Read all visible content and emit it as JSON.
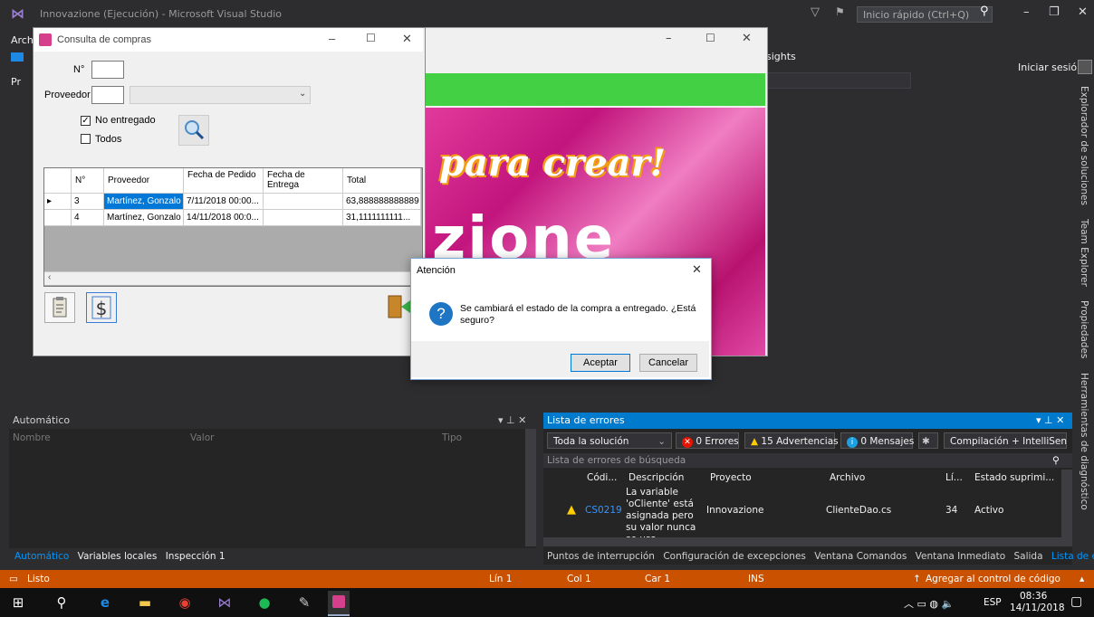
{
  "vs": {
    "title": "Innovazione (Ejecución) - Microsoft Visual Studio",
    "quick_launch_placeholder": "Inicio rápido (Ctrl+Q)",
    "sign_in": "Iniciar sesión",
    "menu_partial": "Arch",
    "insights_partial": "sights",
    "left_partial": "Pr",
    "right_tabs": [
      "Explorador de soluciones",
      "Team Explorer",
      "Propiedades",
      "Herramientas de diagnóstico"
    ]
  },
  "consulta": {
    "title": "Consulta de compras",
    "nro_label": "N°",
    "proveedor_label": "Proveedor",
    "no_entregado_label": "No entregado",
    "no_entregado_checked": true,
    "todos_label": "Todos",
    "todos_checked": false,
    "grid_headers": [
      "N°",
      "Proveedor",
      "Fecha de Pedido",
      "Fecha de Entrega",
      "Total"
    ],
    "rows": [
      {
        "n": "3",
        "proveedor": "Martínez, Gonzalo",
        "fecha_pedido": "7/11/2018 00:00...",
        "fecha_entrega": "",
        "total": "63,888888888889"
      },
      {
        "n": "4",
        "proveedor": "Martínez, Gonzalo",
        "fecha_pedido": "14/11/2018 00:0...",
        "fecha_entrega": "",
        "total": "31,1111111111..."
      }
    ]
  },
  "image_form": {
    "text1": "para crear!",
    "text2": "zione"
  },
  "dialog": {
    "title": "Atención",
    "message": "Se cambiará el estado de la compra a entregado. ¿Está seguro?",
    "ok_label": "Aceptar",
    "cancel_label": "Cancelar"
  },
  "auto_panel": {
    "title": "Automático",
    "columns": [
      "Nombre",
      "Valor",
      "Tipo"
    ],
    "tabs": [
      "Automático",
      "Variables locales",
      "Inspección 1"
    ]
  },
  "errors_panel": {
    "title": "Lista de errores",
    "scope": "Toda la solución",
    "errors_label": "0 Errores",
    "warnings_label": "15 Advertencias",
    "messages_label": "0 Mensajes",
    "build_filter": "Compilación + IntelliSen",
    "search_placeholder": "Lista de errores de búsqueda",
    "columns": [
      "Códi...",
      "Descripción",
      "Proyecto",
      "Archivo",
      "Lí...",
      "Estado suprimi..."
    ],
    "row": {
      "code": "CS0219",
      "description": "La variable 'oCliente' está asignada pero su valor nunca se usa",
      "project": "Innovazione",
      "file": "ClienteDao.cs",
      "line": "34",
      "state": "Activo"
    },
    "bottom_tabs": [
      "Puntos de interrupción",
      "Configuración de excepciones",
      "Ventana Comandos",
      "Ventana Inmediato",
      "Salida",
      "Lista de errores"
    ]
  },
  "statusbar": {
    "status": "Listo",
    "line": "Lín 1",
    "col": "Col 1",
    "car": "Car 1",
    "ins": "INS",
    "source_control": "Agregar al control de código fuente"
  },
  "taskbar": {
    "lang": "ESP",
    "time": "08:36",
    "date": "14/11/2018"
  },
  "colors": {
    "vs_accent": "#007acc",
    "statusbar": "#ca5100",
    "green_bar": "#44d044",
    "pink": "#e23a9c"
  }
}
